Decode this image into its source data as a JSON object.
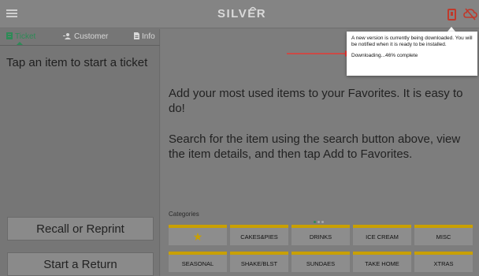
{
  "app": {
    "logo": "SILVER"
  },
  "icons": {
    "menu": "hamburger-icon",
    "device": "device-icon",
    "sync": "cloud-off-icon"
  },
  "colors": {
    "accent": "#2e8b57",
    "category_bar": "#c9a000",
    "alert": "#c0392b"
  },
  "left": {
    "tabs": [
      {
        "label": "Ticket",
        "icon": "ticket-icon",
        "active": true
      },
      {
        "label": "Customer",
        "icon": "customer-icon",
        "active": false
      },
      {
        "label": "Info",
        "icon": "info-icon",
        "active": false
      }
    ],
    "prompt": "Tap an item to start a ticket",
    "recall_label": "Recall or Reprint",
    "return_label": "Start a Return"
  },
  "main": {
    "favorites_hint": "Add your most used items to your Favorites. It is easy to do!",
    "search_hint": "Search for the item using the search button above, view the item details, and then tap Add to Favorites."
  },
  "popup": {
    "message": "A new version is currently being downloaded. You will be notified when it is ready to be installed.",
    "progress": "Downloading...46% complete",
    "progress_value": 46
  },
  "categories": {
    "header": "Categories",
    "items": [
      "★",
      "CAKES&PIES",
      "DRINKS",
      "ICE CREAM",
      "MISC",
      "SEASONAL",
      "SHAKE/BLST",
      "SUNDAES",
      "TAKE HOME",
      "XTRAS"
    ]
  }
}
